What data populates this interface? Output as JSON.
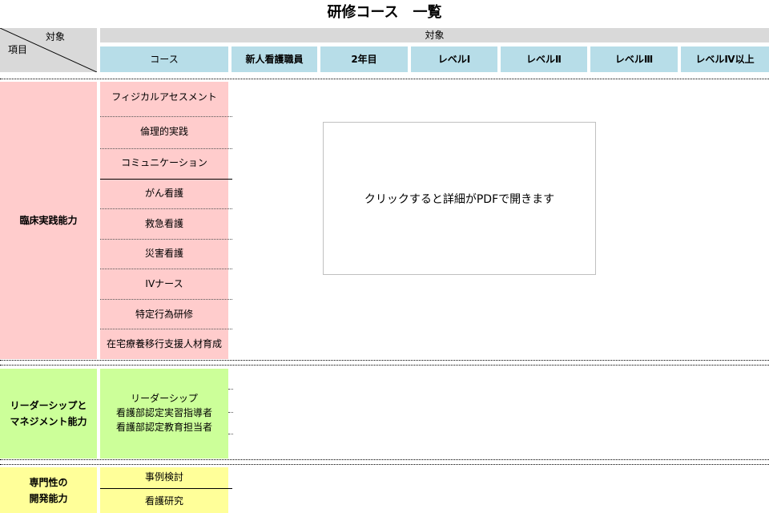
{
  "title": "研修コース　一覧",
  "header": {
    "corner_target": "対象",
    "corner_item": "項目",
    "band_label": "対象",
    "columns": [
      "コース",
      "新人看護職員",
      "2年目",
      "レベルⅠ",
      "レベルⅡ",
      "レベルⅢ",
      "レベルⅣ以上"
    ]
  },
  "sections": [
    {
      "category": "臨床実践能力",
      "courses": [
        "フィジカルアセスメント",
        "倫理的実践",
        "コミュニケーション",
        "がん看護",
        "救急看護",
        "災害看護",
        "IVナース",
        "特定行為研修",
        "在宅療養移行支援人材育成"
      ]
    },
    {
      "category_lines": [
        "リーダーシップと",
        "マネジメント能力"
      ],
      "courses": [
        "リーダーシップ",
        "看護部認定実習指導者",
        "看護部認定教育担当者"
      ]
    },
    {
      "category_lines": [
        "専門性の",
        "開発能力"
      ],
      "courses": [
        "事例検討",
        "看護研究"
      ]
    }
  ],
  "popup_text": "クリックすると詳細がPDFで開きます",
  "colors": {
    "header_gray": "#d9d9d9",
    "header_blue": "#b7dde8",
    "pink": "#ffcccc",
    "green": "#ccff99",
    "yellow": "#ffff99"
  }
}
